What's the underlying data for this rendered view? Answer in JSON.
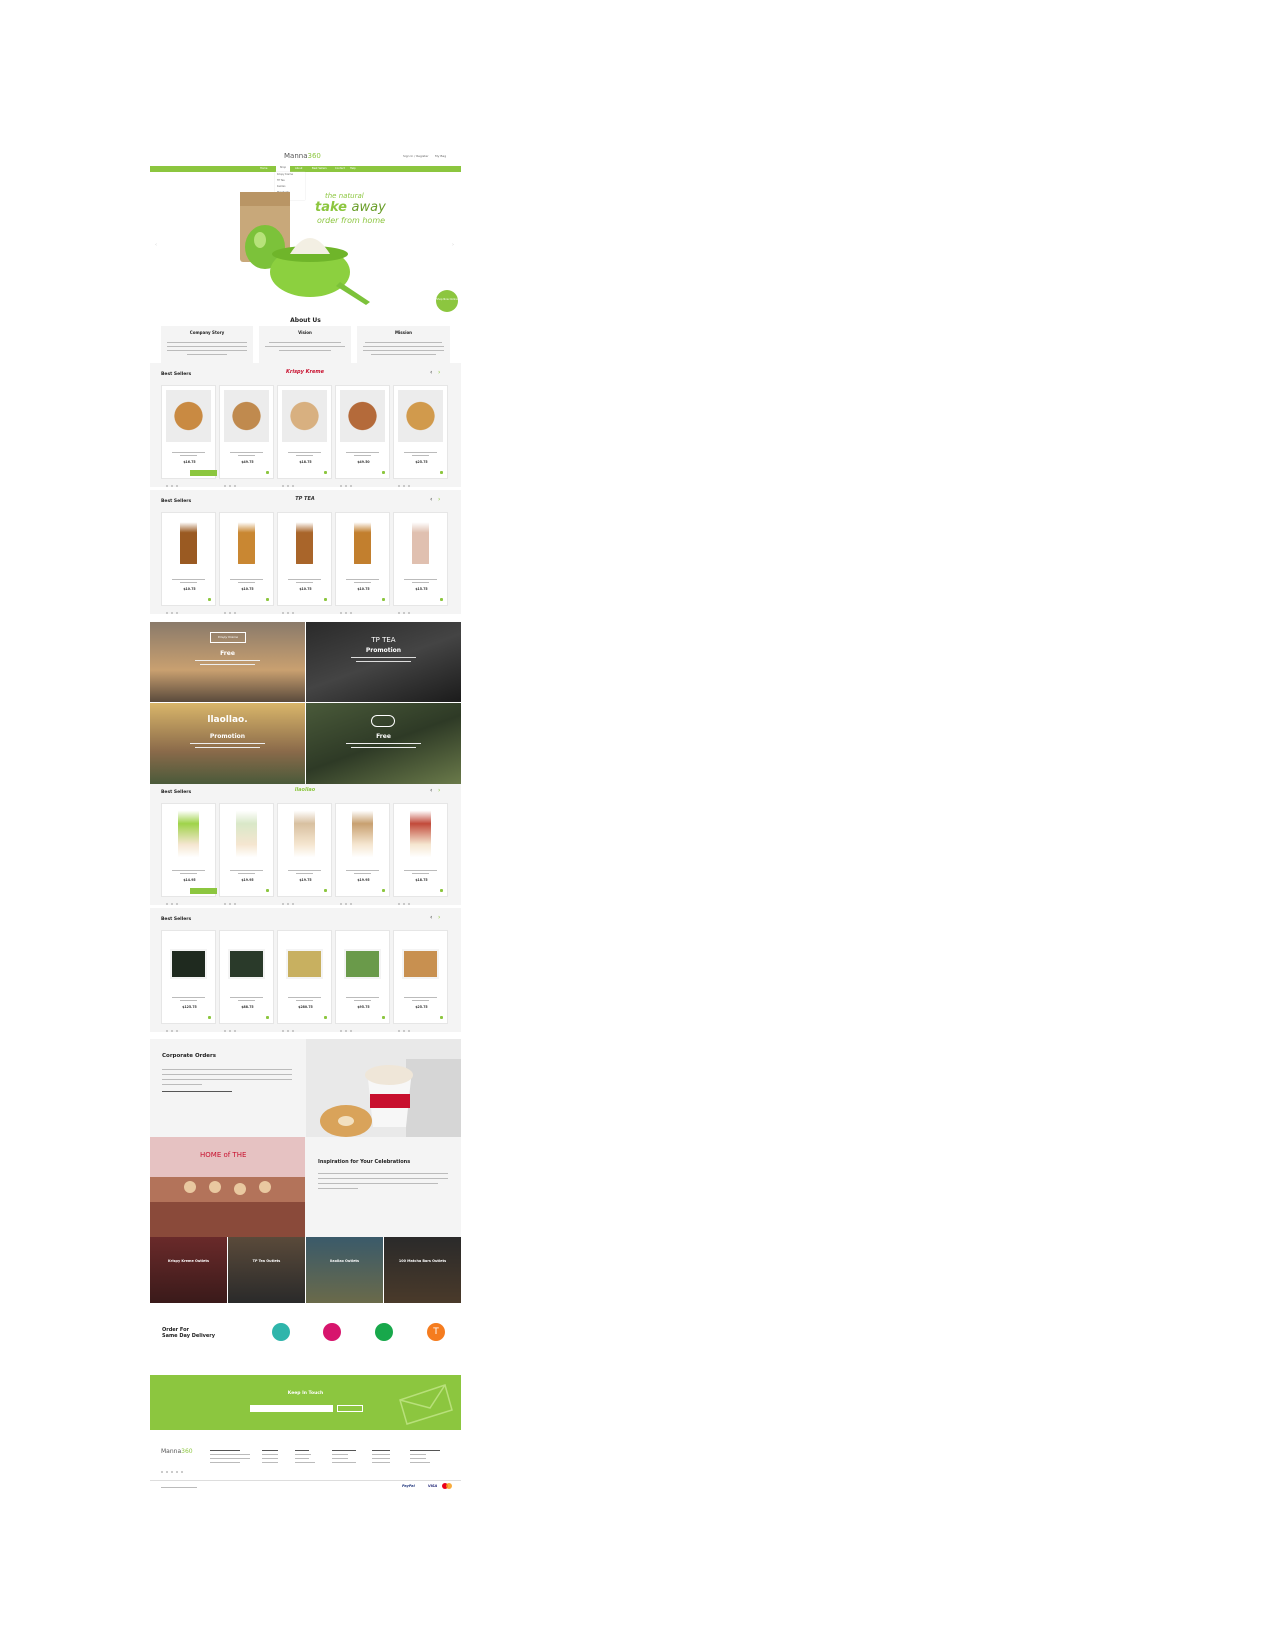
{
  "header": {
    "logo_prefix": "Manna",
    "logo_suffix": "360",
    "nav_right": [
      "Sign In / Register",
      "My Bag"
    ],
    "nav": [
      "Home",
      "Shop",
      "About",
      "Best Sellers",
      "Contact",
      "Help"
    ],
    "dropdown": [
      "Krispy Kreme",
      "TP Tea",
      "llaollao",
      "Merchants"
    ]
  },
  "hero": {
    "line1": "the natural",
    "line2a": "take",
    "line2b": "away",
    "line3": "order from home",
    "badge": "Shop Now Online"
  },
  "about": {
    "title": "About Us",
    "cards": [
      {
        "title": "Company Story"
      },
      {
        "title": "Vision"
      },
      {
        "title": "Mission"
      }
    ]
  },
  "sections": [
    {
      "title": "Best Sellers",
      "brand": "Krispy Kreme",
      "prices": [
        "$16.75",
        "$49.75",
        "$18.75",
        "$49.50",
        "$25.75"
      ]
    },
    {
      "title": "Best Sellers",
      "brand": "TP TEA",
      "prices": [
        "$10.75",
        "$10.75",
        "$10.75",
        "$10.75",
        "$15.75"
      ]
    },
    {
      "title": "Best Sellers",
      "brand": "llaollao",
      "prices": [
        "$14.95",
        "$19.95",
        "$19.75",
        "$19.95",
        "$18.75"
      ]
    },
    {
      "title": "Best Sellers",
      "brand": "",
      "prices": [
        "$125.75",
        "$88.75",
        "$280.75",
        "$95.75",
        "$25.75"
      ]
    }
  ],
  "promos": [
    {
      "brand": "Krispy Kreme",
      "title": "Free"
    },
    {
      "brand": "TP TEA",
      "title": "Promotion"
    },
    {
      "brand": "llaollao.",
      "title": "Promotion"
    },
    {
      "brand": "",
      "title": "Free"
    }
  ],
  "corporate": {
    "title": "Corporate Orders"
  },
  "celebrations": {
    "title": "Inspiration for Your Celebrations"
  },
  "outlets": [
    "Krispy Kreme Outlets",
    "TP Tea Outlets",
    "llaollao Outlets",
    "100 Matcha Bars Outlets"
  ],
  "delivery": {
    "title_line1": "Order For",
    "title_line2": "Same Day Delivery"
  },
  "newsletter": {
    "title": "Keep In Touch"
  },
  "footer": {
    "logo_prefix": "Manna",
    "logo_suffix": "360",
    "payments": [
      "PayPal",
      "VISA"
    ]
  },
  "colors": {
    "accent": "#8cc63f",
    "dark": "#222222"
  }
}
